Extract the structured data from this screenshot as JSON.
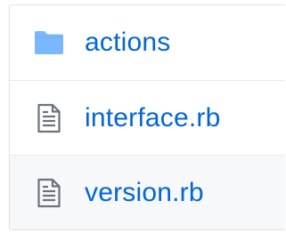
{
  "files": [
    {
      "name": "actions",
      "icon": "folder-icon",
      "type": "directory"
    },
    {
      "name": "interface.rb",
      "icon": "file-text-icon",
      "type": "file"
    },
    {
      "name": "version.rb",
      "icon": "file-text-icon",
      "type": "file"
    }
  ],
  "colors": {
    "link": "#0366d6",
    "folder_icon": "#79b8ff",
    "file_icon": "#6a737d",
    "row_hover_bg": "#f6f8fa",
    "border": "#eaecef"
  }
}
